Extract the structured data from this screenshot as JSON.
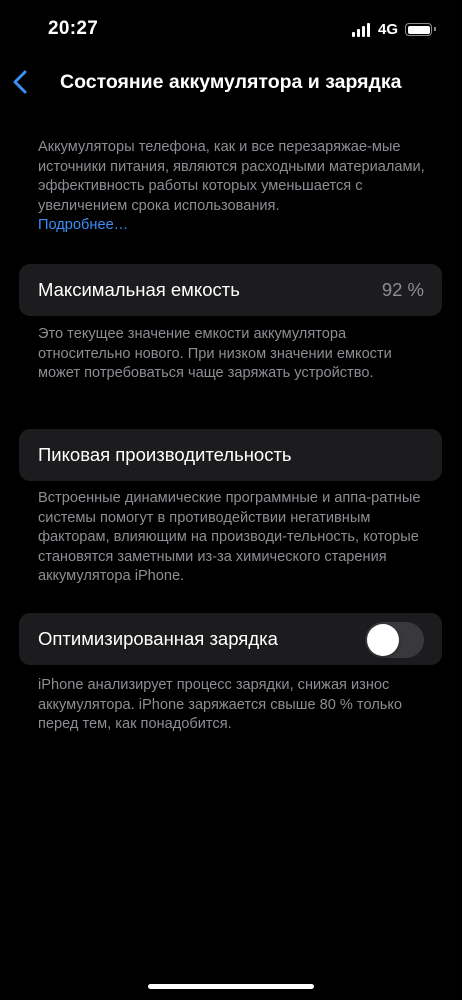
{
  "status_bar": {
    "time": "20:27",
    "network": "4G",
    "icons": [
      "signal-bars-icon",
      "battery-icon"
    ]
  },
  "nav": {
    "back_icon": "chevron-left-icon",
    "title": "Состояние аккумулятора и зарядка"
  },
  "intro": {
    "text": "Аккумуляторы телефона, как и все перезаряжае-мые источники питания, являются расходными материалами, эффективность работы которых уменьшается с увеличением срока использования.",
    "link_label": "Подробнее…"
  },
  "max_capacity": {
    "label": "Максимальная емкость",
    "value": "92 %",
    "footer": "Это текущее значение емкости аккумулятора относительно нового. При низком значении емкости может потребоваться чаще заряжать устройство."
  },
  "peak_performance": {
    "label": "Пиковая производительность",
    "footer": "Встроенные динамические программные и аппа-ратные системы помогут в противодействии негативным факторам, влияющим на производи-тельность, которые становятся заметными из-за химического старения аккумулятора iPhone."
  },
  "optimized_charging": {
    "label": "Оптимизированная зарядка",
    "enabled": false,
    "footer": "iPhone анализирует процесс зарядки, снижая износ аккумулятора. iPhone заряжается свыше 80 % только перед тем, как понадобится."
  },
  "colors": {
    "background": "#000000",
    "card": "#1c1c1e",
    "secondary_text": "#8d8d93",
    "accent": "#3b8ff7",
    "toggle_off": "#39393d"
  }
}
